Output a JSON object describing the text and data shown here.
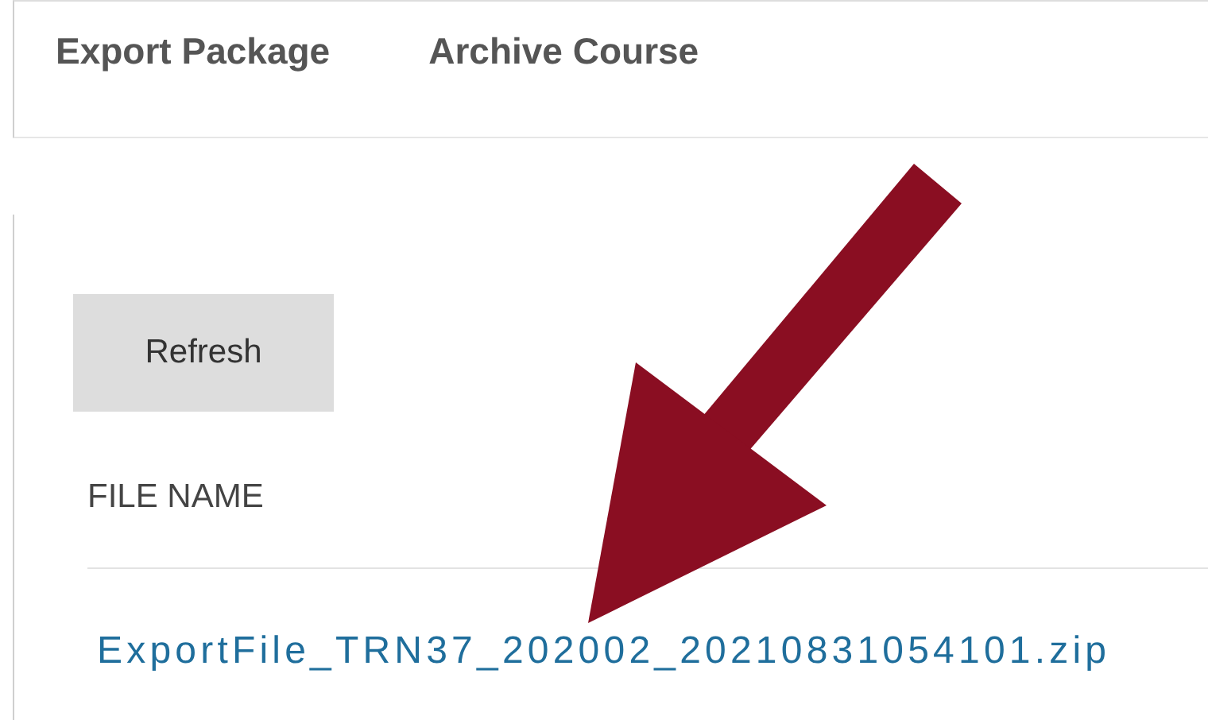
{
  "tabs": [
    {
      "label": "Export Package"
    },
    {
      "label": "Archive Course"
    }
  ],
  "refresh_button": "Refresh",
  "file_list": {
    "column_header": "FILE NAME",
    "files": [
      "ExportFile_TRN37_202002_20210831054101.zip"
    ]
  }
}
